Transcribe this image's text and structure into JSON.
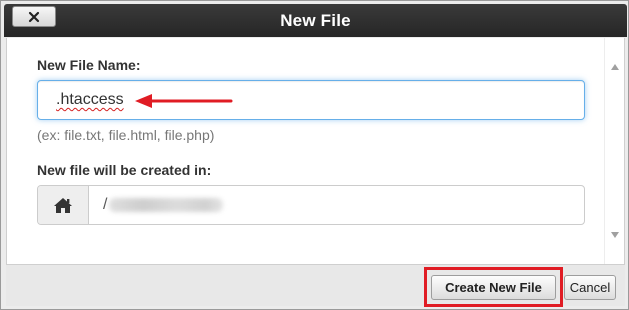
{
  "dialog": {
    "title": "New File",
    "close_icon": "close-x-icon"
  },
  "form": {
    "file_name_label": "New File Name:",
    "file_name_value": ".htaccess",
    "hint": "(ex: file.txt, file.html, file.php)",
    "directory_label": "New file will be created in:",
    "directory_icon": "home-icon",
    "directory_prefix": "/"
  },
  "footer": {
    "create_label": "Create New File",
    "cancel_label": "Cancel"
  },
  "annotations": {
    "arrow_color": "#e01c24",
    "highlight_color": "#e01c24"
  },
  "colors": {
    "titlebar": "#2b2b2b",
    "input_focus": "#66afe9"
  }
}
